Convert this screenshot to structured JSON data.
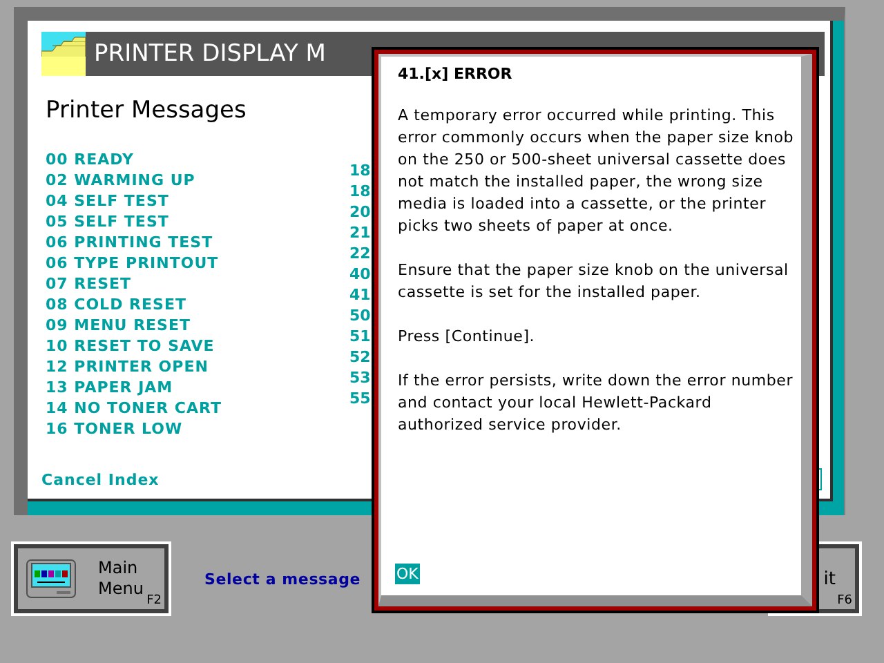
{
  "window": {
    "title": "PRINTER DISPLAY M"
  },
  "heading": "Printer Messages",
  "messages_column_1": [
    "00 READY",
    "02 WARMING UP",
    "04 SELF TEST",
    "05 SELF TEST",
    "06 PRINTING TEST",
    "06 TYPE PRINTOUT",
    "07 RESET",
    "08 COLD RESET",
    "09 MENU RESET",
    "10 RESET TO SAVE",
    "12 PRINTER OPEN",
    "13 PAPER JAM",
    "14 NO TONER CART",
    "16 TONER LOW"
  ],
  "messages_column_2": [
    "18",
    "18",
    "20",
    "21",
    "22",
    "40",
    "41",
    "50",
    "51",
    "52",
    "53",
    "55"
  ],
  "cancel_link": "Cancel Index",
  "bottom_bar": {
    "main_menu": {
      "label_1": "Main",
      "label_2": "Menu",
      "key": "F2"
    },
    "status": "Select a message",
    "exit": {
      "label": "it",
      "key": "F6"
    }
  },
  "dialog": {
    "title": "41.[x] ERROR",
    "paragraphs": [
      "A temporary error occurred while printing. This error commonly occurs when the paper size knob on the 250 or 500-sheet universal cassette does not match the installed paper, the wrong size media is loaded into a cassette, or the printer picks two sheets of paper at once.",
      "Ensure that the paper size knob on the universal cassette is set for the installed paper.",
      "Press [Continue].",
      "If the error persists, write down the error number and contact your local Hewlett-Packard authorized service provider."
    ],
    "ok": "OK"
  }
}
